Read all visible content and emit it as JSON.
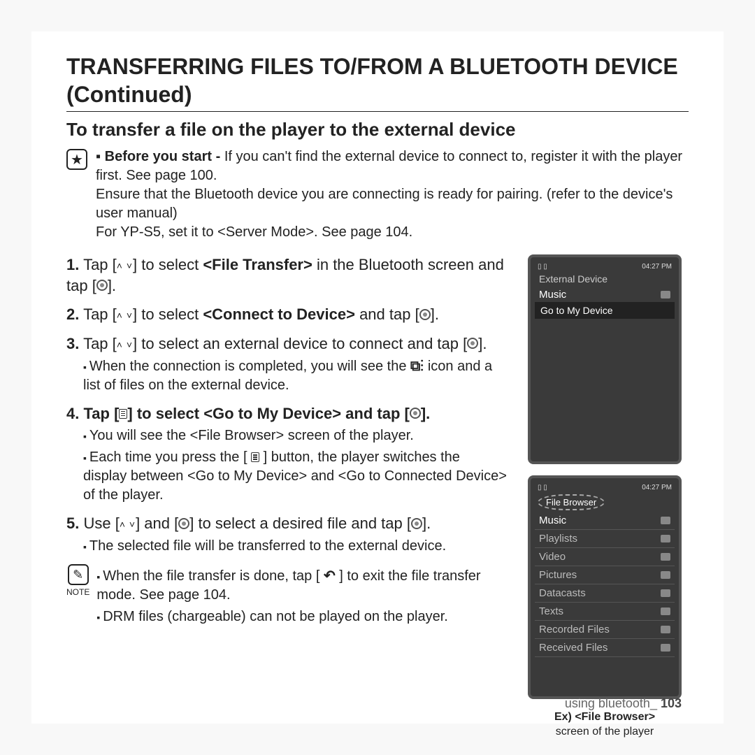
{
  "title": "TRANSFERRING FILES TO/FROM A BLUETOOTH DEVICE (Continued)",
  "subtitle": "To transfer a file on the player to the external device",
  "before": {
    "lead": "Before you start - ",
    "line1": "If you can't find the external device to connect to, register it with the player first. See page 100.",
    "line2": "Ensure that the Bluetooth device you are connecting is ready for pairing. (refer to the device's user manual)",
    "line3": "For YP-S5, set it to <Server Mode>. See page 104."
  },
  "steps": {
    "s1a": "1.",
    "s1b": "  Tap [",
    "s1c": "] to select ",
    "s1d": "<File Transfer>",
    "s1e": " in the Bluetooth screen and tap [",
    "s1f": "].",
    "s2a": "2.",
    "s2b": "  Tap [",
    "s2c": "] to select ",
    "s2d": "<Connect to Device>",
    "s2e": " and tap [",
    "s2f": "].",
    "s3a": "3.",
    "s3b": "  Tap [",
    "s3c": "] to select an external device to connect and tap [",
    "s3d": "].",
    "s3sub": "When the connection is completed, you will see the ",
    "s3sub2": " icon and a list of files on the external device.",
    "s4a": "4.",
    "s4b": "  Tap [",
    "s4c": "] to select ",
    "s4d": "<Go to My Device>",
    "s4e": " and tap [",
    "s4f": "].",
    "s4sub1": "You will see the <File Browser> screen of the player.",
    "s4sub2a": "Each time you press the [ ",
    "s4sub2b": " ] button, the player switches the display between <Go to My Device> and <Go to Connected Device> of the player.",
    "s5a": "5.",
    "s5b": "  Use [",
    "s5c": "] and [",
    "s5d": "] to select a desired file and tap [",
    "s5e": "].",
    "s5sub": "The selected file will be transferred to the external device."
  },
  "notes": {
    "label": "NOTE",
    "n1a": "When the file transfer is done, tap [ ",
    "n1b": " ] to exit the file transfer mode. See page 104.",
    "n2": "DRM files (chargeable) can not be played on the player."
  },
  "device1": {
    "time": "04:27 PM",
    "header": "External Device",
    "item1": "Music",
    "dropdown": "Go to My Device"
  },
  "device2": {
    "time": "04:27 PM",
    "fb": "File Browser",
    "item1": "Music",
    "item2": "Playlists",
    "item3": "Video",
    "item4": "Pictures",
    "item5": "Datacasts",
    "item6": "Texts",
    "item7": "Recorded Files",
    "item8": "Received Files"
  },
  "caption": {
    "b": "Ex) <File Browser>",
    "t": "screen of the player"
  },
  "footer": {
    "text": "using bluetooth_ ",
    "page": "103"
  },
  "glyphs": {
    "bt": "⧉⋮",
    "back": "↶"
  }
}
